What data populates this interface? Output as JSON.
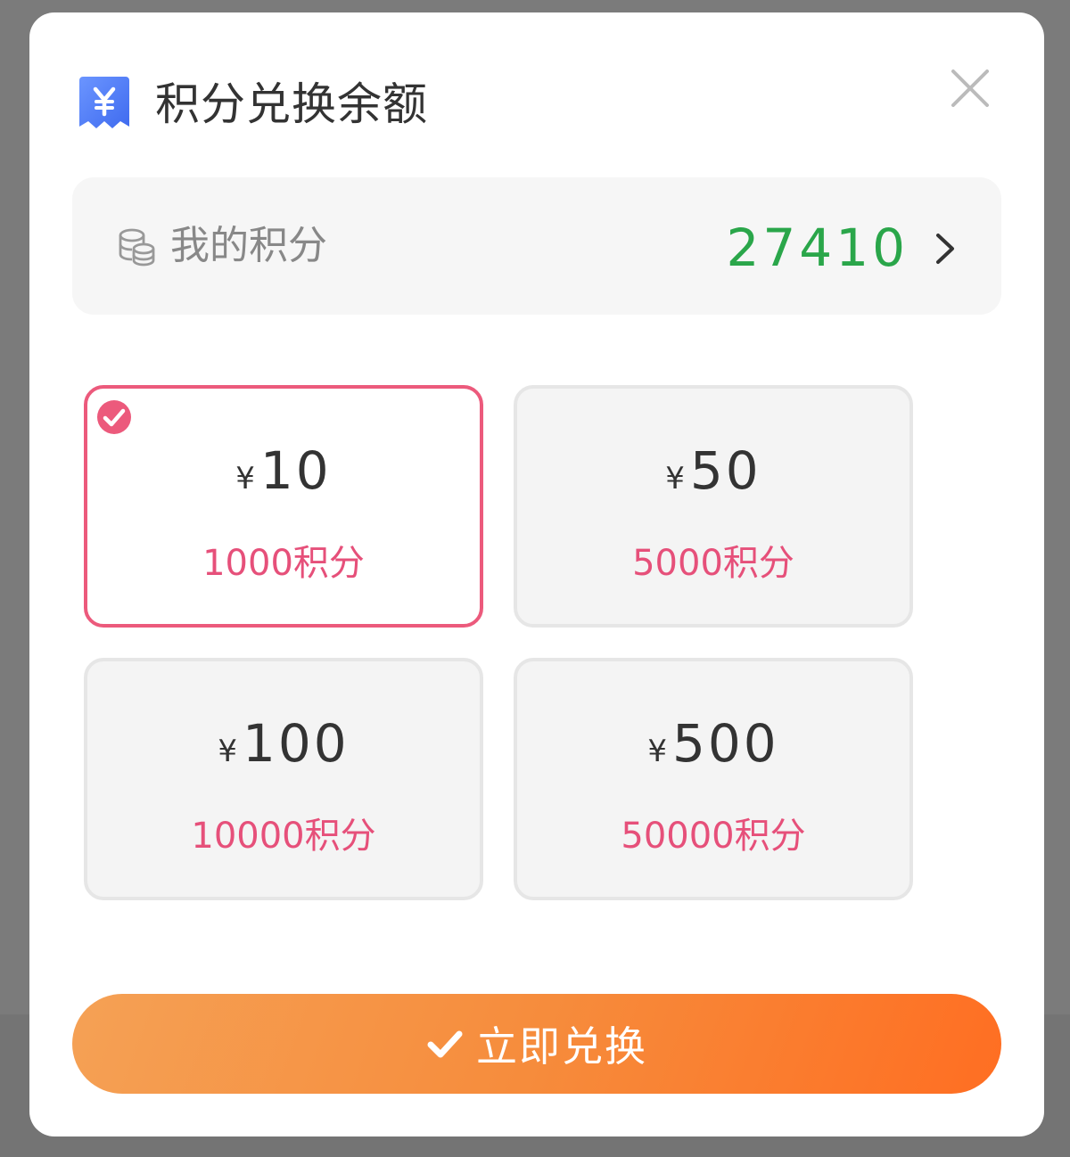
{
  "dialog": {
    "title": "积分兑换余额",
    "icon": "yen-ticket-icon",
    "close_icon": "close-icon"
  },
  "my_points": {
    "label": "我的积分",
    "value": "27410",
    "icon": "coins-icon",
    "chevron_icon": "chevron-right-icon"
  },
  "options": [
    {
      "yen": "¥",
      "amount": "10",
      "points": "1000积分",
      "selected": true
    },
    {
      "yen": "¥",
      "amount": "50",
      "points": "5000积分",
      "selected": false
    },
    {
      "yen": "¥",
      "amount": "100",
      "points": "10000积分",
      "selected": false
    },
    {
      "yen": "¥",
      "amount": "500",
      "points": "50000积分",
      "selected": false
    }
  ],
  "submit": {
    "label": "立即兑换",
    "icon": "check-icon"
  },
  "colors": {
    "accent_pink": "#ec5a7c",
    "points_green": "#2aa64a",
    "button_start": "#f5a155",
    "button_end": "#ff6e22",
    "icon_blue": "#4d7cf5"
  }
}
